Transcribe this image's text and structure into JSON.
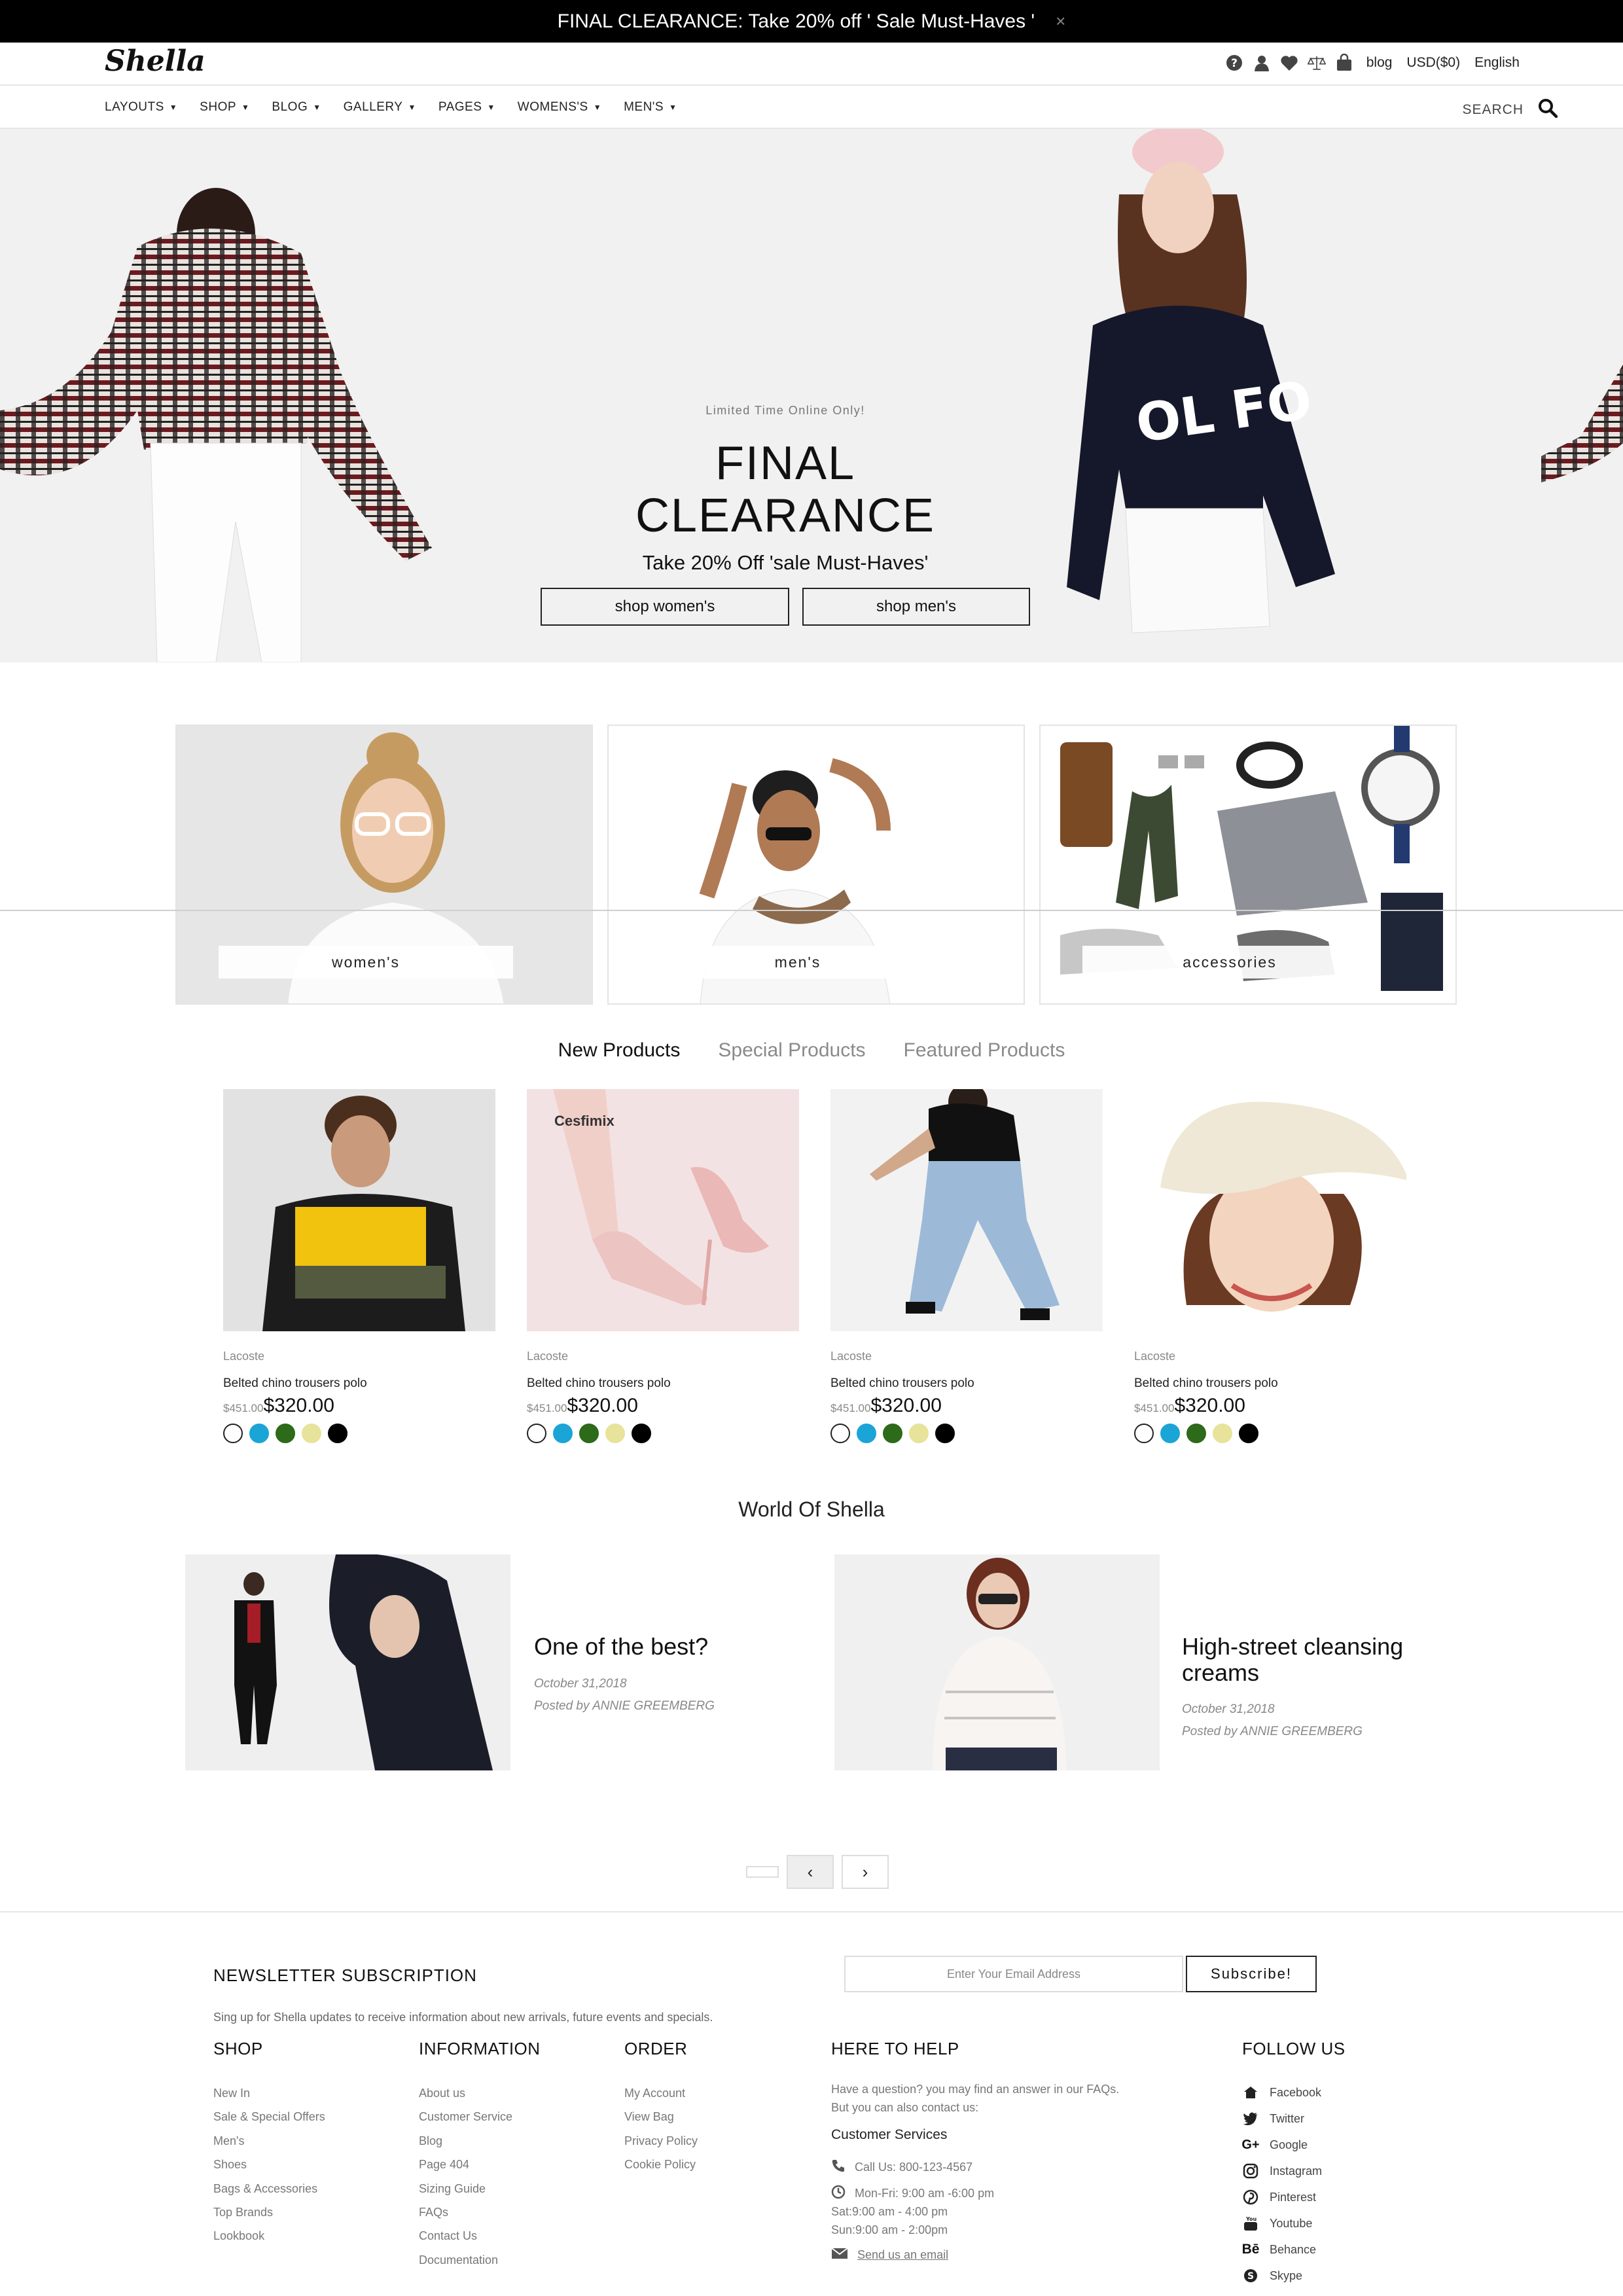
{
  "announcement": {
    "text": "FINAL CLEARANCE: Take 20% off ' Sale Must-Haves '",
    "close": "×"
  },
  "header": {
    "logo": "Shella",
    "links": {
      "blog": "blog",
      "currency": "USD($0)",
      "language": "English"
    },
    "icons": [
      "help-icon",
      "user-icon",
      "heart-icon",
      "compare-icon",
      "bag-icon"
    ]
  },
  "nav": {
    "items": [
      "LAYOUTS",
      "SHOP",
      "BLOG",
      "GALLERY",
      "PAGES",
      "WOMENS'S",
      "MEN'S"
    ],
    "search_label": "SEARCH"
  },
  "hero": {
    "kicker": "Limited Time Online Only!",
    "title_line1": "FINAL",
    "title_line2": "CLEARANCE",
    "subtitle": "Take 20% Off 'sale Must-Haves'",
    "btn_women": "shop women's",
    "btn_men": "shop men's"
  },
  "categories": [
    "women's",
    "men's",
    "accessories"
  ],
  "product_tabs": [
    "New Products",
    "Special Products",
    "Featured Products"
  ],
  "product_tabs_active": 0,
  "products": [
    {
      "brand": "Lacoste",
      "name": "Belted chino trousers polo",
      "old_price": "$451.00",
      "price": "$320.00",
      "image_label": ""
    },
    {
      "brand": "Lacoste",
      "name": "Belted chino trousers polo",
      "old_price": "$451.00",
      "price": "$320.00",
      "image_label": "Cesfimix"
    },
    {
      "brand": "Lacoste",
      "name": "Belted chino trousers polo",
      "old_price": "$451.00",
      "price": "$320.00",
      "image_label": ""
    },
    {
      "brand": "Lacoste",
      "name": "Belted chino trousers polo",
      "old_price": "$451.00",
      "price": "$320.00",
      "image_label": ""
    }
  ],
  "swatch_colors": [
    "#ffffff",
    "#1aa5d6",
    "#2d6a1a",
    "#e8e39a",
    "#000000"
  ],
  "world": {
    "title": "World Of Shella",
    "posts": [
      {
        "title": "One of the best?",
        "date": "October 31,2018",
        "author": "Posted by ANNIE GREEMBERG"
      },
      {
        "title": "High-street cleansing creams",
        "date": "October 31,2018",
        "author": "Posted by ANNIE GREEMBERG"
      }
    ]
  },
  "pager": {
    "prev": "‹",
    "next": "›"
  },
  "newsletter": {
    "title": "NEWSLETTER SUBSCRIPTION",
    "text": "Sing up for Shella updates to receive information about new arrivals, future events and specials.",
    "placeholder": "Enter Your Email Address",
    "button": "Subscribe!"
  },
  "footer": {
    "shop": {
      "title": "SHOP",
      "items": [
        "New In",
        "Sale & Special Offers",
        "Men's",
        "Shoes",
        "Bags & Accessories",
        "Top Brands",
        "Lookbook"
      ]
    },
    "information": {
      "title": "INFORMATION",
      "items": [
        "About us",
        "Customer Service",
        "Blog",
        "Page 404",
        "Sizing Guide",
        "FAQs",
        "Contact Us",
        "Documentation"
      ]
    },
    "order": {
      "title": "ORDER",
      "items": [
        "My Account",
        "View Bag",
        "Privacy Policy",
        "Cookie Policy"
      ]
    },
    "help": {
      "title": "HERE TO HELP",
      "text1": "Have a question? you may find an answer in our FAQs.",
      "text2": "But you can also contact us:",
      "cs_title": "Customer Services",
      "phone": "Call Us: 800-123-4567",
      "hours1": "Mon-Fri: 9:00 am -6:00 pm",
      "hours2": "Sat:9:00 am - 4:00 pm",
      "hours3": "Sun:9:00 am - 2:00pm",
      "email": "Send us an email"
    },
    "follow": {
      "title": "FOLLOW US",
      "items": [
        "Facebook",
        "Twitter",
        "Google",
        "Instagram",
        "Pinterest",
        "Youtube",
        "Behance",
        "Skype"
      ]
    }
  }
}
